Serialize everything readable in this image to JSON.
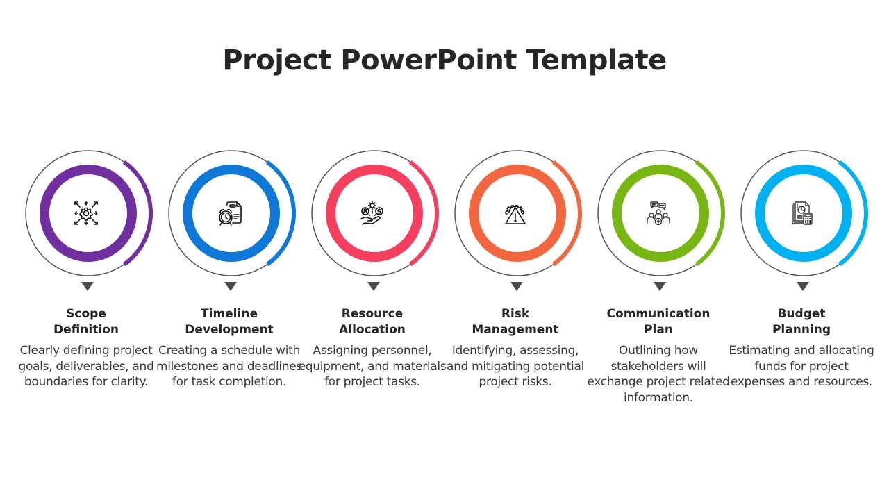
{
  "slide": {
    "title": "Project PowerPoint Template"
  },
  "steps": [
    {
      "heading_line1": "Scope",
      "heading_line2": "Definition",
      "description": "Clearly defining project goals, deliverables, and boundaries for clarity.",
      "color": "#7030A0",
      "icon": "gear-arrows-icon"
    },
    {
      "heading_line1": "Timeline",
      "heading_line2": "Development",
      "description": "Creating a schedule with milestones and deadlines for task completion.",
      "color": "#0F78D6",
      "icon": "alarm-clock-document-icon"
    },
    {
      "heading_line1": "Resource",
      "heading_line2": "Allocation",
      "description": "Assigning personnel, equipment, and materials for project tasks.",
      "color": "#F43F5E",
      "icon": "hand-resources-icon"
    },
    {
      "heading_line1": "Risk",
      "heading_line2": "Management",
      "description": "Identifying, assessing, and mitigating potential project risks.",
      "color": "#F26640",
      "icon": "warning-gear-icon"
    },
    {
      "heading_line1": "Communication",
      "heading_line2": "Plan",
      "description": "Outlining how stakeholders will exchange project related information.",
      "color": "#77B613",
      "icon": "team-chat-icon"
    },
    {
      "heading_line1": "Budget",
      "heading_line2": "Planning",
      "description": "Estimating and allocating funds for project expenses and resources.",
      "color": "#00B0F0",
      "icon": "calculator-report-icon"
    }
  ]
}
